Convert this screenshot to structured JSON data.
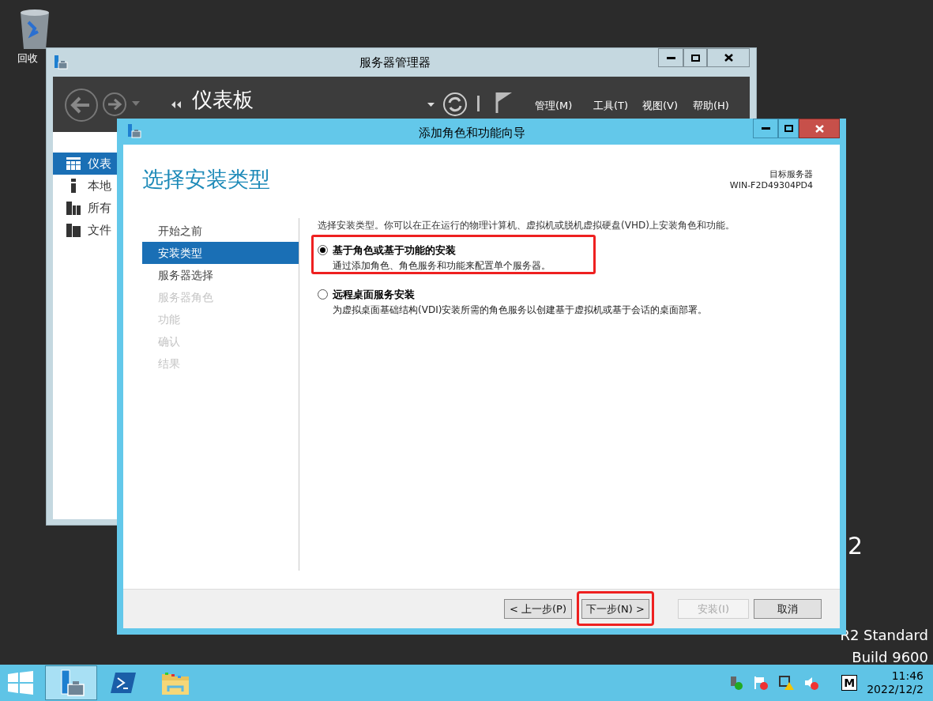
{
  "desktop": {
    "icons": [
      {
        "label": "回收"
      }
    ],
    "branding": [
      "2",
      "R2 Standard",
      "Build 9600"
    ]
  },
  "server_manager": {
    "title": "服务器管理器",
    "page_title": "仪表板",
    "menu": [
      "管理(M)",
      "工具(T)",
      "视图(V)",
      "帮助(H)"
    ],
    "sidebar": [
      {
        "label": "仪表",
        "selected": true
      },
      {
        "label": "本地",
        "selected": false
      },
      {
        "label": "所有",
        "selected": false
      },
      {
        "label": "文件",
        "selected": false
      }
    ]
  },
  "wizard": {
    "title": "添加角色和功能向导",
    "heading": "选择安装类型",
    "target_label": "目标服务器",
    "target_server": "WIN-F2D49304PD4",
    "steps": [
      {
        "label": "开始之前",
        "selected": false,
        "disabled": false
      },
      {
        "label": "安装类型",
        "selected": true,
        "disabled": false
      },
      {
        "label": "服务器选择",
        "selected": false,
        "disabled": false
      },
      {
        "label": "服务器角色",
        "selected": false,
        "disabled": true
      },
      {
        "label": "功能",
        "selected": false,
        "disabled": true
      },
      {
        "label": "确认",
        "selected": false,
        "disabled": true
      },
      {
        "label": "结果",
        "selected": false,
        "disabled": true
      }
    ],
    "intro": "选择安装类型。你可以在正在运行的物理计算机、虚拟机或脱机虚拟硬盘(VHD)上安装角色和功能。",
    "options": [
      {
        "title": "基于角色或基于功能的安装",
        "description": "通过添加角色、角色服务和功能来配置单个服务器。",
        "selected": true,
        "highlighted": true
      },
      {
        "title": "远程桌面服务安装",
        "description": "为虚拟桌面基础结构(VDI)安装所需的角色服务以创建基于虚拟机或基于会话的桌面部署。",
        "selected": false,
        "highlighted": false
      }
    ],
    "buttons": [
      {
        "label": "< 上一步(P)",
        "disabled": false,
        "highlighted": false
      },
      {
        "label": "下一步(N) >",
        "disabled": false,
        "highlighted": true
      },
      {
        "label": "安装(I)",
        "disabled": true,
        "highlighted": false
      },
      {
        "label": "取消",
        "disabled": false,
        "highlighted": false
      }
    ]
  },
  "taskbar": {
    "apps": [
      {
        "kind": "server",
        "selected": true
      },
      {
        "kind": "shell",
        "selected": false
      },
      {
        "kind": "folder",
        "selected": false
      }
    ],
    "ime": "M",
    "time": "11:46",
    "date": "2022/12/2"
  }
}
